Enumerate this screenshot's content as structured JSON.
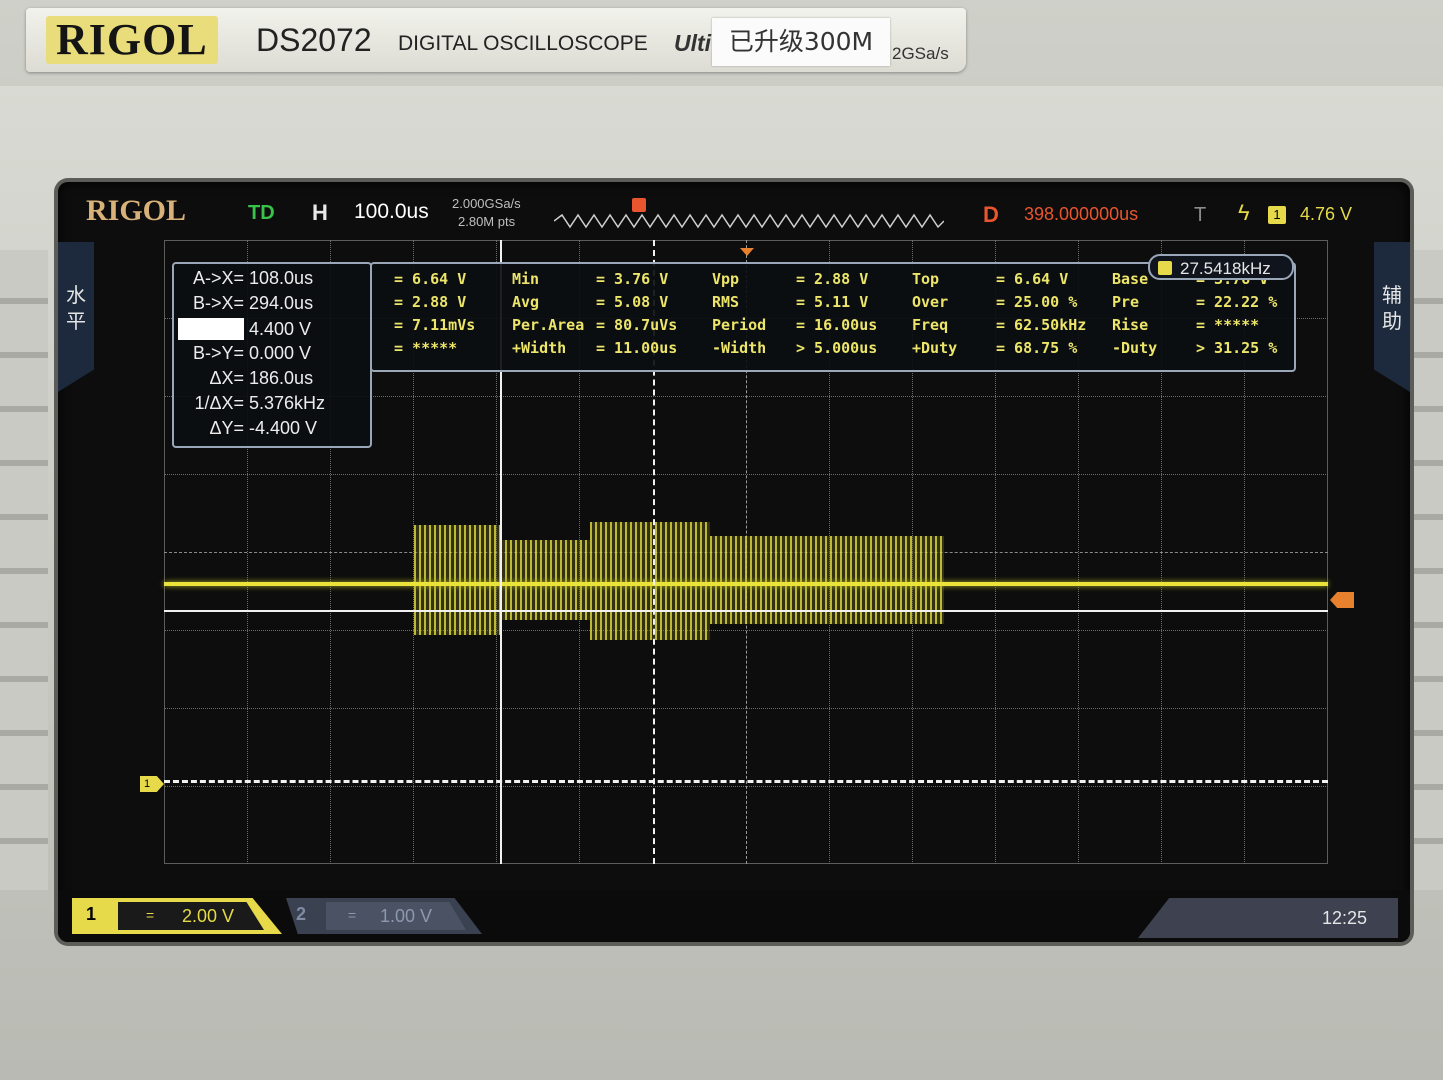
{
  "label": {
    "brand": "RIGOL",
    "model": "DS2072",
    "description": "DIGITAL OSCILLOSCOPE",
    "ultra": "Ulti",
    "sticker": "已升级300M",
    "rate": "2GSa/s"
  },
  "screen": {
    "brand": "RIGOL",
    "status": "TD",
    "h_label": "H",
    "timebase": "100.0us",
    "sample_rate": "2.000GSa/s",
    "mem_depth": "2.80M pts",
    "delay_label": "D",
    "delay": "398.000000us",
    "trigger_label": "T",
    "trigger_edge": "ϟ",
    "trigger_channel": "1",
    "trigger_level": "4.76 V",
    "side_left": "水平",
    "side_right": "辅助"
  },
  "cursors": {
    "ax": {
      "label": "A->X=",
      "value": "108.0us"
    },
    "bx": {
      "label": "B->X=",
      "value": "294.0us"
    },
    "ay": {
      "label": "",
      "value": "4.400 V"
    },
    "by": {
      "label": "B->Y=",
      "value": "0.000 V"
    },
    "dx": {
      "label": "ΔX=",
      "value": "186.0us"
    },
    "invdx": {
      "label": "1/ΔX=",
      "value": "5.376kHz"
    },
    "dy": {
      "label": "ΔY=",
      "value": "-4.400 V"
    }
  },
  "measure": {
    "freq_counter": "27.5418kHz",
    "rows": [
      [
        "= 6.64 V",
        "Min",
        "= 3.76 V",
        "Vpp",
        "= 2.88 V",
        "Top",
        "= 6.64 V",
        "Base",
        "= 3.76 V"
      ],
      [
        "= 2.88 V",
        "Avg",
        "= 5.08 V",
        "RMS",
        "= 5.11 V",
        "Over",
        "= 25.00 %",
        "Pre",
        "= 22.22 %"
      ],
      [
        "= 7.11mVs",
        "Per.Area",
        "= 80.7uVs",
        "Period",
        "= 16.00us",
        "Freq",
        "= 62.50kHz",
        "Rise",
        "= *****"
      ],
      [
        "= *****",
        "+Width",
        "= 11.00us",
        "-Width",
        "> 5.000us",
        "+Duty",
        "= 68.75 %",
        "-Duty",
        "> 31.25 %"
      ]
    ]
  },
  "channels": {
    "ch1": {
      "number": "1",
      "coupling": "=",
      "scale": "2.00 V"
    },
    "ch2": {
      "number": "2",
      "coupling": "=",
      "scale": "1.00 V"
    }
  },
  "markers": {
    "ch1": "1",
    "trigger": "T"
  },
  "clock": "12:25",
  "colors": {
    "ch1": "#e6da4a",
    "trigger": "#e8552e",
    "panel_border": "#9aa7b8"
  }
}
